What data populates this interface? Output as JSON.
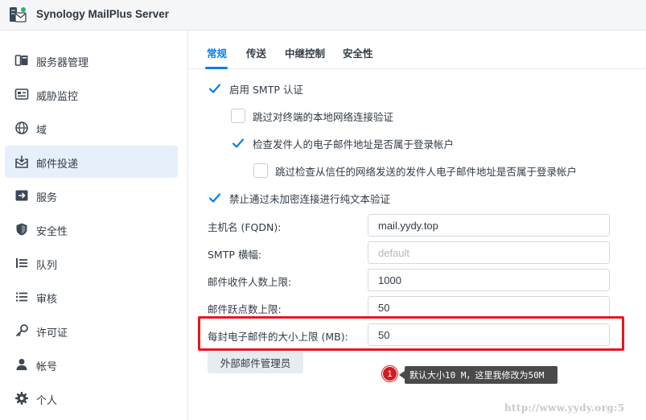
{
  "app": {
    "title": "Synology MailPlus Server"
  },
  "sidebar": {
    "items": [
      {
        "label": "服务器管理",
        "icon": "server-icon"
      },
      {
        "label": "威胁监控",
        "icon": "monitor-icon"
      },
      {
        "label": "域",
        "icon": "globe-icon"
      },
      {
        "label": "邮件投递",
        "icon": "mail-delivery-icon",
        "active": true
      },
      {
        "label": "服务",
        "icon": "service-icon"
      },
      {
        "label": "安全性",
        "icon": "shield-icon"
      },
      {
        "label": "队列",
        "icon": "queue-icon"
      },
      {
        "label": "审核",
        "icon": "audit-list-icon"
      },
      {
        "label": "许可证",
        "icon": "key-icon"
      },
      {
        "label": "帐号",
        "icon": "user-icon"
      },
      {
        "label": "个人",
        "icon": "gear-icon"
      }
    ]
  },
  "tabs": [
    {
      "label": "常规",
      "active": true
    },
    {
      "label": "传送"
    },
    {
      "label": "中继控制"
    },
    {
      "label": "安全性"
    }
  ],
  "options": {
    "smtp_auth": {
      "label": "启用 SMTP 认证",
      "checked": true
    },
    "skip_terminal": {
      "label": "跳过对终端的本地网络连接验证",
      "checked": false
    },
    "check_sender": {
      "label": "检查发件人的电子邮件地址是否属于登录帐户",
      "checked": true
    },
    "skip_trusted": {
      "label": "跳过检查从信任的网络发送的发件人电子邮件地址是否属于登录帐户",
      "checked": false
    },
    "no_plaintext": {
      "label": "禁止通过未加密连接进行纯文本验证",
      "checked": true
    }
  },
  "fields": {
    "hostname": {
      "label": "主机名 (FQDN):",
      "value": "mail.yydy.top",
      "placeholder": ""
    },
    "smtp_banner": {
      "label": "SMTP 横幅:",
      "value": "",
      "placeholder": "default"
    },
    "max_recipients": {
      "label": "邮件收件人数上限:",
      "value": "1000",
      "placeholder": ""
    },
    "max_hops": {
      "label": "邮件跃点数上限:",
      "value": "50",
      "placeholder": ""
    },
    "max_size": {
      "label": "每封电子邮件的大小上限 (MB):",
      "value": "50",
      "placeholder": ""
    }
  },
  "buttons": {
    "external_admin": "外部邮件管理员"
  },
  "annotation": {
    "number": "1",
    "text": "默认大小10 M，这里我修改为50M"
  },
  "watermark": "http://www.yydy.org:5",
  "colors": {
    "accent": "#057feb",
    "highlight": "#e8171c",
    "annotation_dot": "#d11c24",
    "sidebar_active": "#e6f0fa"
  }
}
